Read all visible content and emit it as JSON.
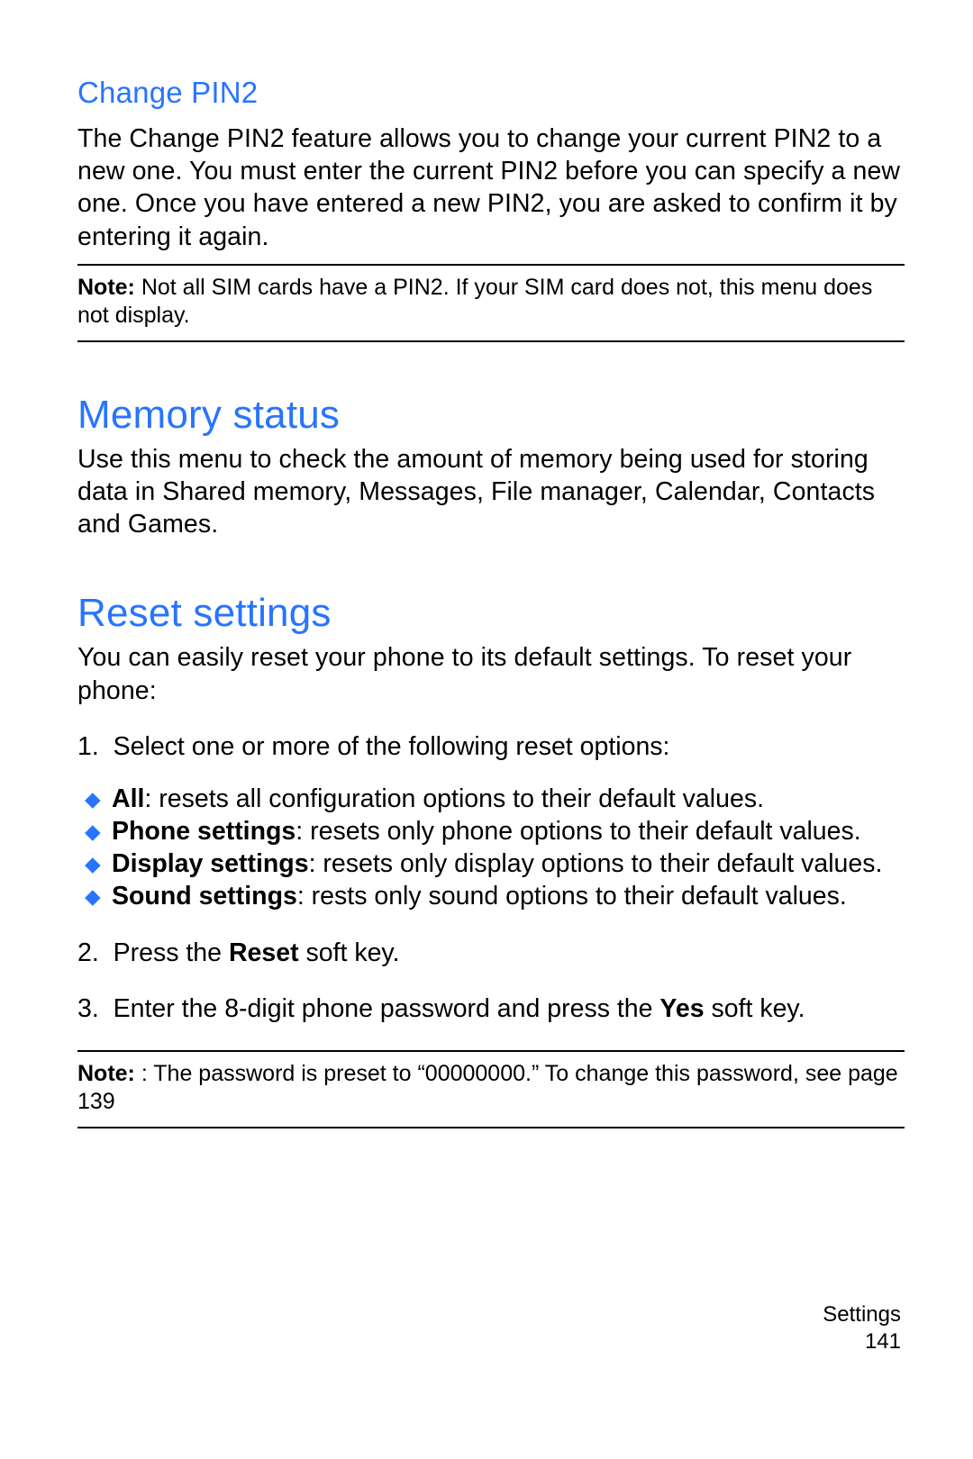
{
  "section_pin2": {
    "heading": "Change PIN2",
    "paragraph": "The Change PIN2 feature allows you to change your current PIN2 to a new one. You must enter the current PIN2 before you can specify a new one. Once you have entered a new PIN2, you are asked to confirm it by entering it again.",
    "note_label": "Note:",
    "note_text": " Not all SIM cards have a PIN2. If your SIM card does not, this menu does not display."
  },
  "section_memory": {
    "heading": "Memory status",
    "paragraph": "Use this menu to check the amount of memory being used for storing data in Shared memory, Messages, File manager, Calendar, Contacts and Games."
  },
  "section_reset": {
    "heading": "Reset settings",
    "intro": "You can easily reset your phone to its default settings. To reset your phone:",
    "step1_num": "1.",
    "step1_text": "Select one or more of the following reset options:",
    "bullets": [
      {
        "bold": "All",
        "rest": ": resets all configuration options to their default values."
      },
      {
        "bold": "Phone settings",
        "rest": ": resets only phone options to their default values."
      },
      {
        "bold": "Display settings",
        "rest": ": resets only display options to their default values."
      },
      {
        "bold": "Sound settings",
        "rest": ": rests only sound options to their default values."
      }
    ],
    "step2_num": "2.",
    "step2_a": "Press the ",
    "step2_bold": "Reset",
    "step2_b": " soft key.",
    "step3_num": "3.",
    "step3_a": "Enter the 8-digit phone password and press the ",
    "step3_bold": "Yes",
    "step3_b": " soft key.",
    "note_label": "Note:",
    "note_text": " : The password is preset to “00000000.” To change this password, see page 139"
  },
  "footer": {
    "section": "Settings",
    "page": "141"
  }
}
